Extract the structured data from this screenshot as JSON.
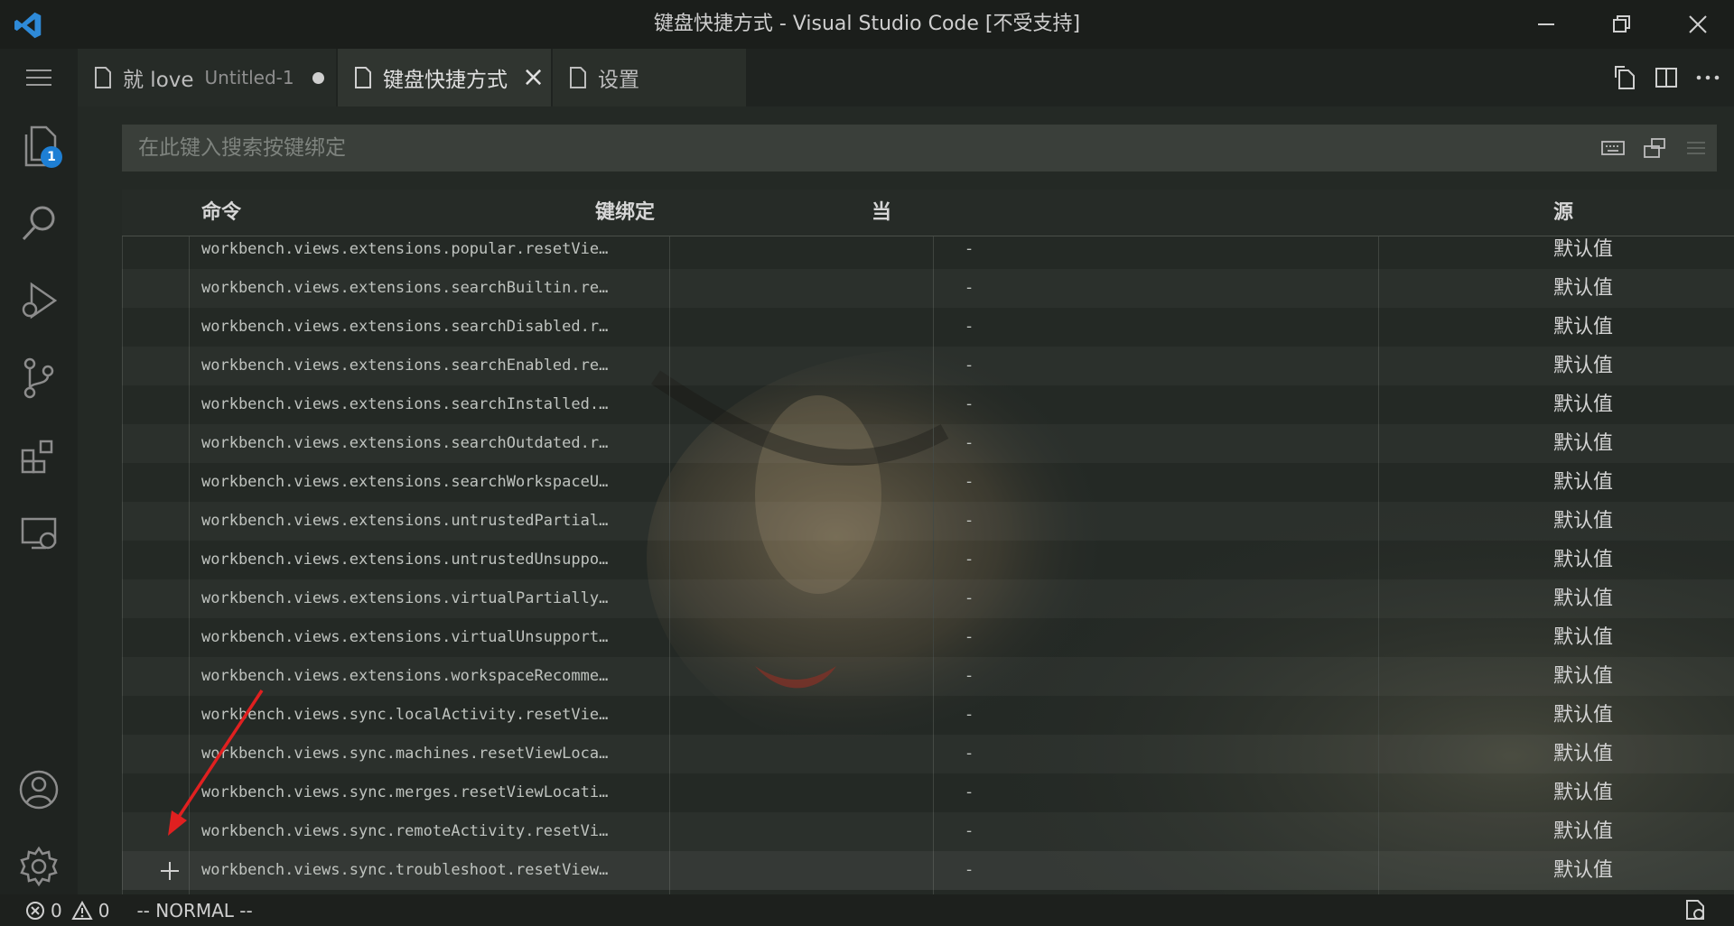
{
  "window": {
    "title": "键盘快捷方式 - Visual Studio Code [不受支持]"
  },
  "tabs": [
    {
      "label": "就 love",
      "description": "Untitled-1",
      "dirty": true
    },
    {
      "label": "键盘快捷方式",
      "active": true
    },
    {
      "label": "设置"
    }
  ],
  "activity_bar": {
    "explorer_badge": "1",
    "icons": [
      "explorer-icon",
      "search-icon",
      "run-debug-icon",
      "source-control-icon",
      "extensions-icon",
      "remote-explorer-icon",
      "accounts-icon",
      "manage-gear-icon"
    ]
  },
  "search": {
    "placeholder": "在此键入搜索按键绑定",
    "value": ""
  },
  "table": {
    "headers": {
      "command": "命令",
      "keybinding": "键绑定",
      "when": "当",
      "source": "源"
    },
    "rows": [
      {
        "command": "workbench.views.extensions.popular.resetVie…",
        "when": "-",
        "source": "默认值"
      },
      {
        "command": "workbench.views.extensions.searchBuiltin.re…",
        "when": "-",
        "source": "默认值"
      },
      {
        "command": "workbench.views.extensions.searchDisabled.r…",
        "when": "-",
        "source": "默认值"
      },
      {
        "command": "workbench.views.extensions.searchEnabled.re…",
        "when": "-",
        "source": "默认值"
      },
      {
        "command": "workbench.views.extensions.searchInstalled.…",
        "when": "-",
        "source": "默认值"
      },
      {
        "command": "workbench.views.extensions.searchOutdated.r…",
        "when": "-",
        "source": "默认值"
      },
      {
        "command": "workbench.views.extensions.searchWorkspaceU…",
        "when": "-",
        "source": "默认值"
      },
      {
        "command": "workbench.views.extensions.untrustedPartial…",
        "when": "-",
        "source": "默认值"
      },
      {
        "command": "workbench.views.extensions.untrustedUnsuppo…",
        "when": "-",
        "source": "默认值"
      },
      {
        "command": "workbench.views.extensions.virtualPartially…",
        "when": "-",
        "source": "默认值"
      },
      {
        "command": "workbench.views.extensions.virtualUnsupport…",
        "when": "-",
        "source": "默认值"
      },
      {
        "command": "workbench.views.extensions.workspaceRecomme…",
        "when": "-",
        "source": "默认值"
      },
      {
        "command": "workbench.views.sync.localActivity.resetVie…",
        "when": "-",
        "source": "默认值"
      },
      {
        "command": "workbench.views.sync.machines.resetViewLoca…",
        "when": "-",
        "source": "默认值"
      },
      {
        "command": "workbench.views.sync.merges.resetViewLocati…",
        "when": "-",
        "source": "默认值"
      },
      {
        "command": "workbench.views.sync.remoteActivity.resetVi…",
        "when": "-",
        "source": "默认值"
      },
      {
        "command": "workbench.views.sync.troubleshoot.resetView…",
        "when": "-",
        "source": "默认值"
      }
    ]
  },
  "statusbar": {
    "errors": "0",
    "warnings": "0",
    "mode": "-- NORMAL --"
  }
}
